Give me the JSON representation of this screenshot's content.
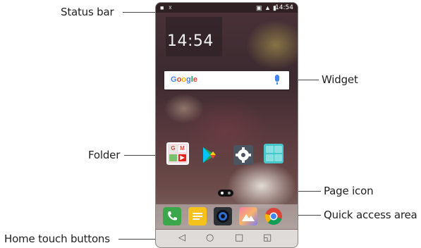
{
  "callouts": {
    "status_bar": "Status bar",
    "widget": "Widget",
    "folder": "Folder",
    "page_icon": "Page icon",
    "quick_access_area": "Quick access area",
    "home_touch_buttons": "Home touch buttons"
  },
  "phone": {
    "status_bar": {
      "time": "14:54",
      "icons": [
        "notification-icon",
        "usb-icon",
        "nfc-icon",
        "signal-icon",
        "battery-icon"
      ]
    },
    "clock_widget": {
      "time": "14:54"
    },
    "search_widget": {
      "logo": "Google",
      "icons": [
        "microphone-icon"
      ]
    },
    "home_icons": [
      "folder-icon",
      "play-store-icon",
      "settings-icon",
      "apps-folder-icon"
    ],
    "dock_apps": [
      "phone-icon",
      "messages-icon",
      "camera-icon",
      "gallery-icon",
      "chrome-icon"
    ],
    "nav_buttons": [
      "back-icon",
      "home-icon",
      "recents-icon",
      "dual-window-icon"
    ],
    "colors": {
      "dock_phone": "#3aa84a",
      "dock_messages": "#f5c21b",
      "dock_camera": "#2c3136",
      "dock_chrome_red": "#db4437",
      "google_blue": "#4285F4"
    }
  }
}
